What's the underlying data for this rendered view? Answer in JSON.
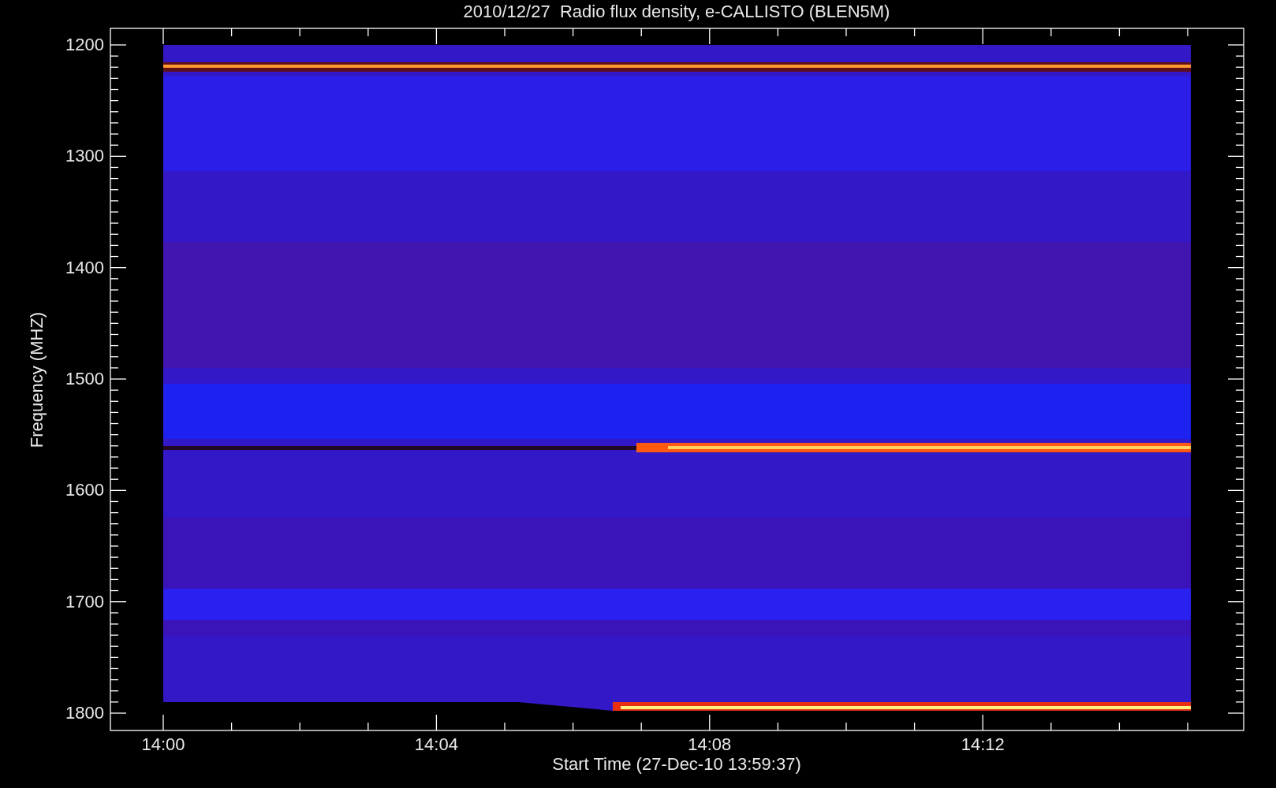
{
  "title": "2010/12/27  Radio flux density, e-CALLISTO (BLEN5M)",
  "y_axis": {
    "label": "Frequency (MHZ)",
    "ticks": [
      "1200",
      "1300",
      "1400",
      "1500",
      "1600",
      "1700",
      "1800"
    ]
  },
  "x_axis": {
    "label": "Start Time (27-Dec-10 13:59:37)",
    "ticks": [
      "14:00",
      "14:04",
      "14:08",
      "14:12"
    ]
  }
}
